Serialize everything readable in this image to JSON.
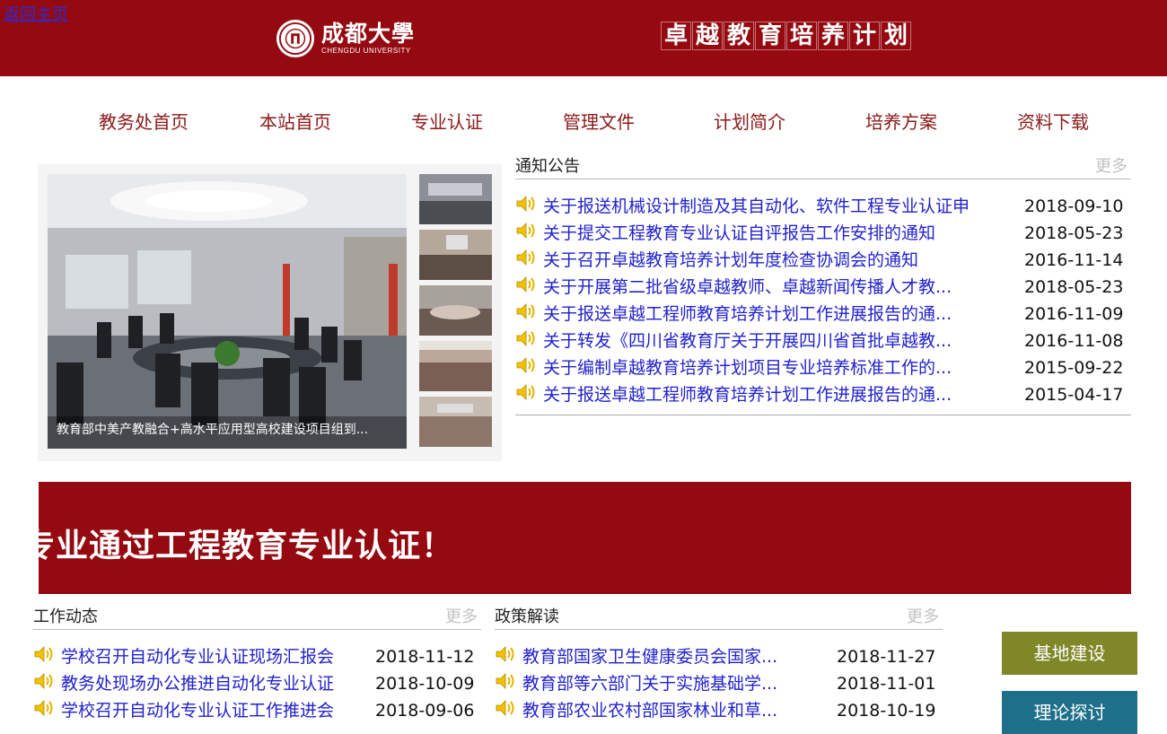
{
  "back_link": "返回主页",
  "header": {
    "logo_cn": "成都大學",
    "logo_en": "CHENGDU UNIVERSITY",
    "plan_title_chars": [
      "卓",
      "越",
      "教",
      "育",
      "培",
      "养",
      "计",
      "划"
    ]
  },
  "nav": [
    "教务处首页",
    "本站首页",
    "专业认证",
    "管理文件",
    "计划简介",
    "培养方案",
    "资料下载"
  ],
  "slider": {
    "caption": "教育部中美产教融合+高水平应用型高校建设项目组到..."
  },
  "notices": {
    "title": "通知公告",
    "more": "更多",
    "items": [
      {
        "title": "关于报送机械设计制造及其自动化、软件工程专业认证申",
        "date": "2018-09-10"
      },
      {
        "title": "关于提交工程教育专业认证自评报告工作安排的通知",
        "date": "2018-05-23"
      },
      {
        "title": "关于召开卓越教育培养计划年度检查协调会的通知",
        "date": "2016-11-14"
      },
      {
        "title": "关于开展第二批省级卓越教师、卓越新闻传播人才教...",
        "date": "2018-05-23"
      },
      {
        "title": "关于报送卓越工程师教育培养计划工作进展报告的通...",
        "date": "2016-11-09"
      },
      {
        "title": "关于转发《四川省教育厅关于开展四川省首批卓越教...",
        "date": "2016-11-08"
      },
      {
        "title": "关于编制卓越教育培养计划项目专业培养标准工作的...",
        "date": "2015-09-22"
      },
      {
        "title": "关于报送卓越工程师教育培养计划工作进展报告的通...",
        "date": "2015-04-17"
      }
    ]
  },
  "banner": "专业通过工程教育专业认证！",
  "work_news": {
    "title": "工作动态",
    "more": "更多",
    "items": [
      {
        "title": "学校召开自动化专业认证现场汇报会",
        "date": "2018-11-12"
      },
      {
        "title": "教务处现场办公推进自动化专业认证",
        "date": "2018-10-09"
      },
      {
        "title": "学校召开自动化专业认证工作推进会",
        "date": "2018-09-06"
      }
    ]
  },
  "policy": {
    "title": "政策解读",
    "more": "更多",
    "items": [
      {
        "title": "教育部国家卫生健康委员会国家...",
        "date": "2018-11-27"
      },
      {
        "title": "教育部等六部门关于实施基础学...",
        "date": "2018-11-01"
      },
      {
        "title": "教育部农业农村部国家林业和草...",
        "date": "2018-10-19"
      }
    ]
  },
  "side_buttons": [
    {
      "label": "基地建设",
      "color": "#7f8726"
    },
    {
      "label": "理论探讨",
      "color": "#1d6f8a"
    }
  ]
}
